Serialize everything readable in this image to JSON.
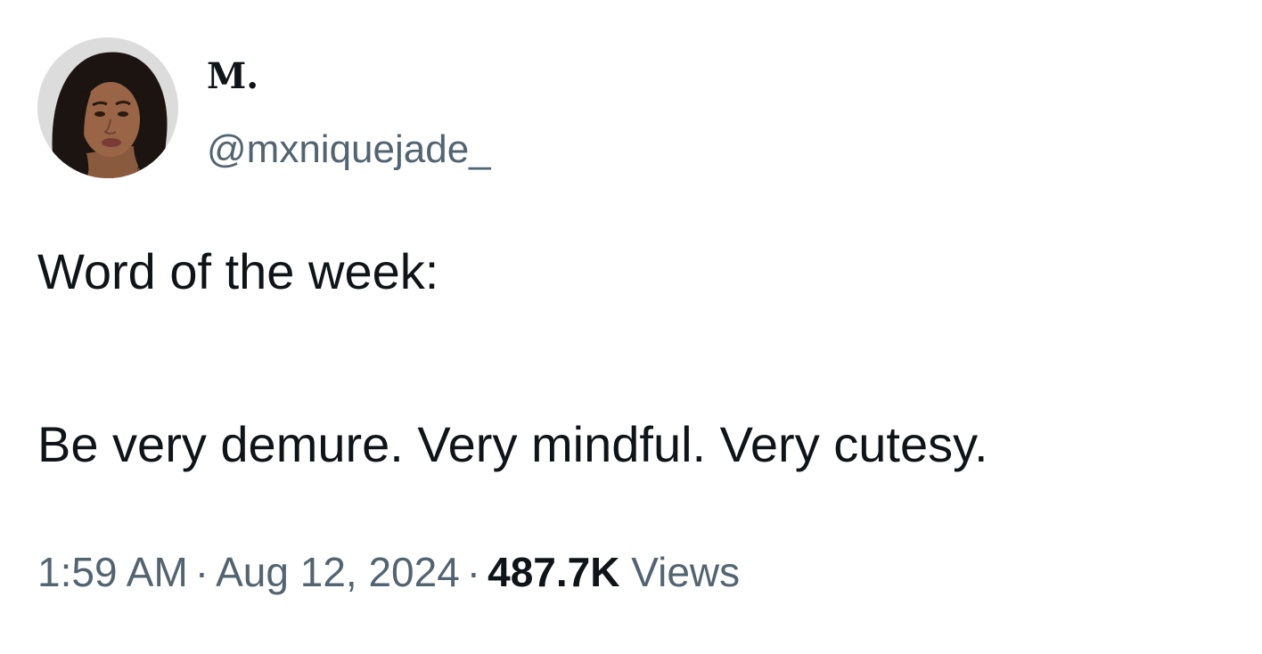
{
  "author": {
    "display_name": "M.",
    "handle": "@mxniquejade_"
  },
  "tweet": {
    "lines": [
      "Word of the week:",
      "Be very demure. Very mindful. Very cutesy."
    ]
  },
  "meta": {
    "time": "1:59 AM",
    "separator": "·",
    "date": "Aug 12, 2024",
    "views_count": "487.7K",
    "views_label": "Views"
  },
  "colors": {
    "text_primary": "#0f1419",
    "text_secondary": "#536471",
    "background": "#ffffff"
  },
  "icons": {
    "avatar": "profile-photo"
  }
}
